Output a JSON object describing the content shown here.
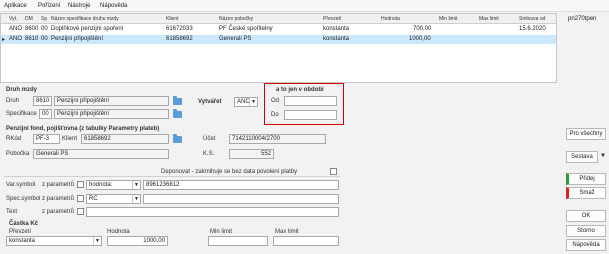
{
  "menu": [
    "Aplikace",
    "Pořízení",
    "Nástroje",
    "Nápověda"
  ],
  "user": "pn270tpen",
  "table": {
    "headers": [
      "Vyt.",
      "DM",
      "Sp",
      "Název specifikace druhu mzdy",
      "Klient",
      "Název pobočky",
      "Převzetí",
      "Hodnota",
      "Min limit",
      "Max limit",
      "Smlouva od"
    ],
    "rows": [
      {
        "vyt": "ANO",
        "dm": "8600",
        "sp": "00",
        "spec": "Doplňkové penzijní spoření",
        "klient": "61672033",
        "pobocka": "PF České spořitelny",
        "prevzeti": "konstanta",
        "hodnota": "700,00",
        "min": "",
        "max": "",
        "smlouva": "15.6.2020"
      },
      {
        "vyt": "ANO",
        "dm": "8610",
        "sp": "00",
        "spec": "Penzijní připojištění",
        "klient": "61858692",
        "pobocka": "Generali PS",
        "prevzeti": "konstanta",
        "hodnota": "1000,00",
        "min": "",
        "max": "",
        "smlouva": ""
      }
    ]
  },
  "druh_mzdy": {
    "title": "Druh mzdy",
    "druh_label": "Druh",
    "druh_code": "8610",
    "druh_name": "Penzijní připojištění",
    "spec_label": "Specifikace",
    "spec_code": "00",
    "spec_name": "Penzijní připojištění",
    "vytvaret_label": "Vytvářet",
    "vytvaret_value": "ANO"
  },
  "period": {
    "title": "a to jen v období",
    "od_label": "Od",
    "od_value": "",
    "do_label": "Do",
    "do_value": ""
  },
  "fond": {
    "title": "Penzijní fond, pojišťovna (z tabulky Parametry plateb)",
    "rkod_label": "RKód",
    "rkod_value": "PF-3",
    "klient_label": "Klient",
    "klient_value": "61858692",
    "ucet_label": "Účet",
    "ucet_value": "7142110004/2700",
    "pobocka_label": "Pobočka",
    "pobocka_value": "Generali PS",
    "ks_label": "K.S.",
    "ks_value": "552",
    "deponovat_label": "Deponovat - zakmihuje se bez data povolení platby"
  },
  "symbols": {
    "var_label": "Var.symbol",
    "var_from_param": "z parametrů",
    "var_select": "hodnota:",
    "var_value": "8961236812",
    "spec_label": "Spec.symbol",
    "spec_from_param": "z parametrů",
    "spec_select": "RČ",
    "spec_value": "",
    "text_label": "Text",
    "text_from_param": "z parametrů",
    "text_value": ""
  },
  "castka": {
    "title": "Částka Kč",
    "prevzeti_label": "Převzetí",
    "prevzeti_value": "konstanta",
    "hodnota_label": "Hodnota",
    "hodnota_value": "1000,00",
    "min_label": "Min limit",
    "min_value": "",
    "max_label": "Max limit",
    "max_value": ""
  },
  "buttons": {
    "pro_vsechny": "Pro všechny",
    "sestava": "Sestava",
    "pridej": "Přidej",
    "smaz": "Smaž",
    "ok": "OK",
    "storno": "Storno",
    "napoveda": "Nápověda"
  },
  "colors": {
    "selected_row": "#cce8ff",
    "highlight_box": "#cc0000",
    "add_accent": "#2e9b3c",
    "delete_accent": "#dd2222"
  }
}
